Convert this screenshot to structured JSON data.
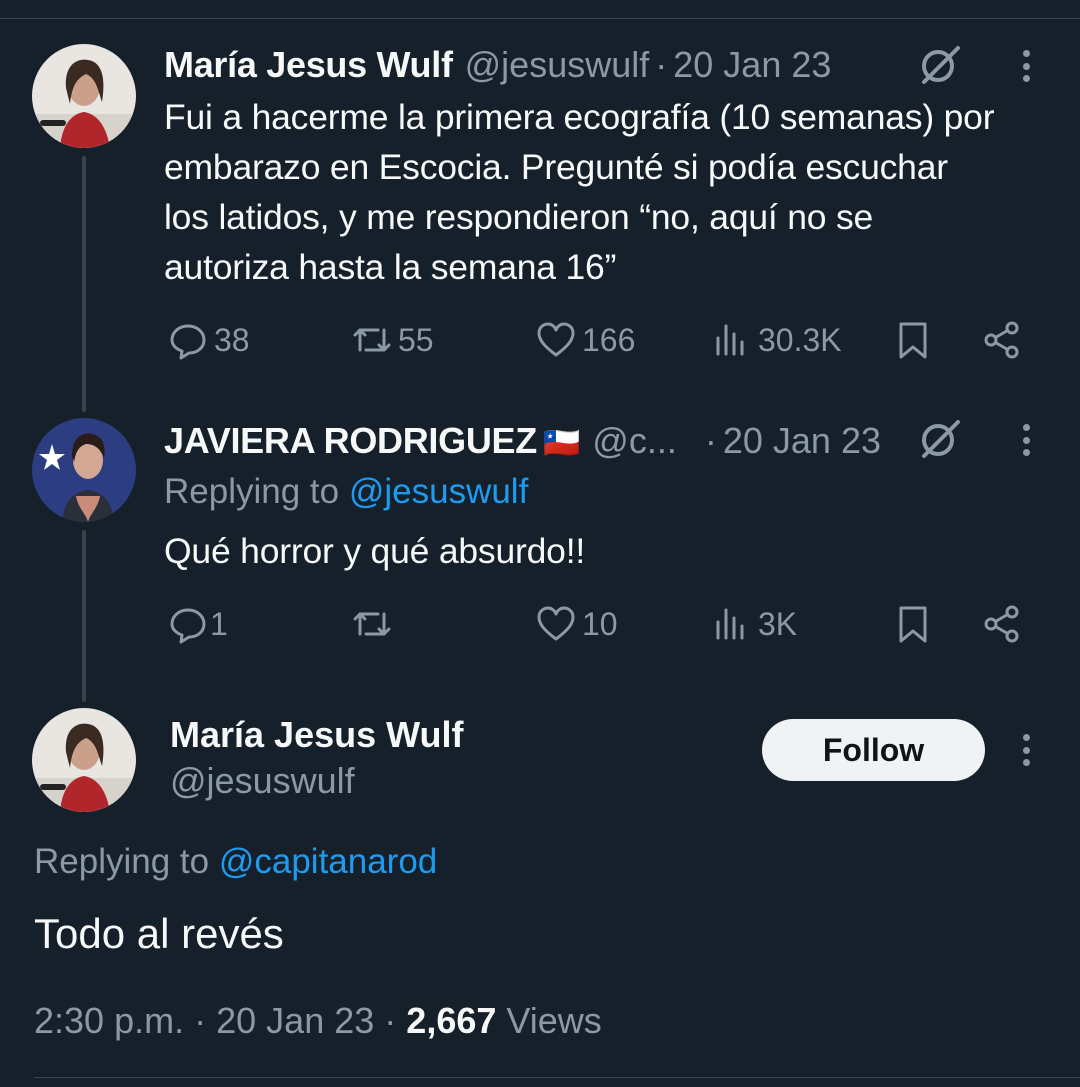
{
  "tweet1": {
    "name": "María Jesus Wulf",
    "handle": "@jesuswulf",
    "dot": "·",
    "date": "20 Jan 23",
    "text_lines": [
      "Fui a hacerme la primera ecografía (10 semanas) por",
      "embarazo en Escocia. Pregunté si podía escuchar",
      "los latidos, y me respondieron “no, aquí no se",
      "autoriza hasta la semana 16”"
    ],
    "replies": "38",
    "retweets": "55",
    "likes": "166",
    "views": "30.3K"
  },
  "tweet2": {
    "name": "JAVIERA RODRIGUEZ",
    "flag": "🇨🇱",
    "handle": "@c...",
    "dot": "·",
    "date": "20 Jan 23",
    "replying_label": "Replying to ",
    "replying_handle": "@jesuswulf",
    "text": "Qué horror y qué absurdo!!",
    "replies": "1",
    "likes": "10",
    "views": "3K"
  },
  "main": {
    "name": "María Jesus Wulf",
    "handle": "@jesuswulf",
    "follow_label": "Follow",
    "replying_label": "Replying to ",
    "replying_handle": "@capitanarod",
    "text": "Todo al revés",
    "time": "2:30 p.m.",
    "dot": "·",
    "date": "20 Jan 23",
    "views_count": "2,667",
    "views_label": "Views"
  },
  "colors": {
    "background": "#15202b",
    "text": "#f7f9f9",
    "muted": "#8b98a5",
    "link": "#1d9bf0",
    "divider": "#38444d"
  },
  "icons": [
    "reply-icon",
    "retweet-icon",
    "like-icon",
    "views-icon",
    "bookmark-icon",
    "share-icon",
    "grok-icon",
    "more-icon"
  ]
}
